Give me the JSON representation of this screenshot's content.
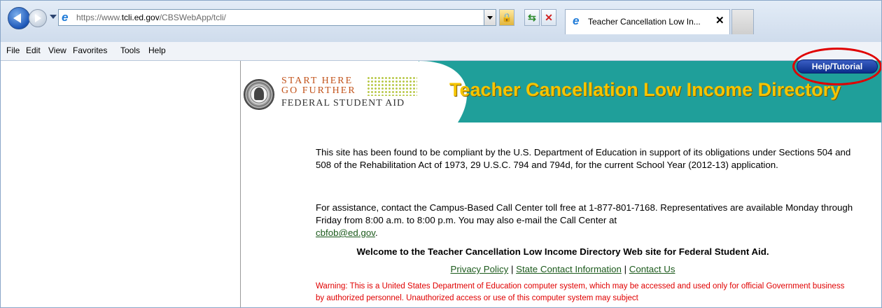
{
  "browser": {
    "url_prefix": "https://www.",
    "url_domain": "tcli.ed.gov",
    "url_path": "/CBSWebApp/tcli/",
    "tab_title": "Teacher Cancellation Low In...",
    "tab_close": "✕"
  },
  "menu": [
    "File",
    "Edit",
    "View",
    "Favorites",
    "Tools",
    "Help"
  ],
  "banner": {
    "logo_line1": "START HERE",
    "logo_line2": "GO FURTHER",
    "logo_line3": "FEDERAL STUDENT AID",
    "title": "Teacher Cancellation Low Income Directory",
    "help_button": "Help/Tutorial"
  },
  "content": {
    "compliance": "This site has been found to be compliant by the U.S. Department of Education in support of its obligations under Sections 504 and 508 of the Rehabilitation Act of 1973, 29 U.S.C. 794 and 794d, for the current School Year (2012-13) application.",
    "assistance": "For assistance, contact the Campus-Based Call Center toll free at 1-877-801-7168. Representatives are available Monday through Friday from 8:00 a.m. to 8:00 p.m. You may also e-mail the Call Center at",
    "email": "cbfob@ed.gov",
    "email_suffix": ".",
    "welcome": "Welcome to the Teacher Cancellation Low Income Directory Web site for Federal Student Aid.",
    "links": [
      "Privacy Policy",
      "State Contact Information",
      "Contact Us"
    ],
    "separator": " | ",
    "warning": "Warning: This is a United States Department of Education computer system, which may be accessed and used only for official Government business by authorized personnel. Unauthorized access or use of this computer system may subject"
  },
  "colors": {
    "banner_teal": "#1f9f9a",
    "title_yellow": "#f5c400",
    "help_blue": "#0b2d8a",
    "highlight_red": "#e00000",
    "link_green": "#1c5a1c",
    "warning_red": "#e00000"
  },
  "icons": [
    "back-icon",
    "forward-icon",
    "ie-icon",
    "lock-icon",
    "compatibility-icon",
    "stop-icon",
    "close-icon",
    "seal-icon"
  ]
}
